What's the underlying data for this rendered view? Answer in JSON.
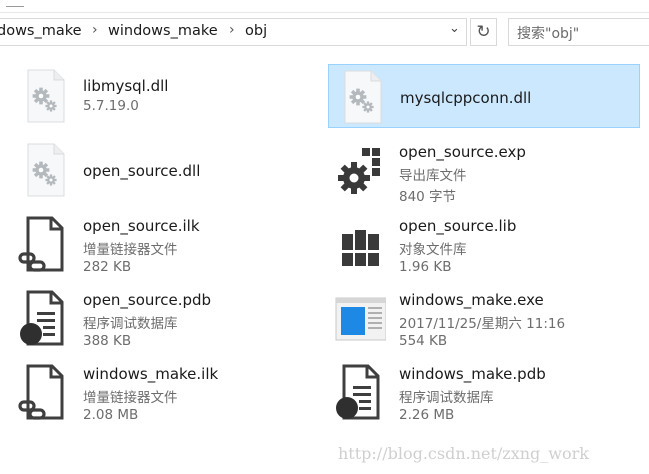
{
  "address": {
    "crumbs": [
      "dows_make",
      "windows_make",
      "obj"
    ],
    "dropdown_icon": "chevron-down",
    "refresh_icon": "refresh"
  },
  "search": {
    "placeholder": "搜索\"obj\""
  },
  "files": [
    {
      "name": "libmysql.dll",
      "detail": "5.7.19.0",
      "icon": "dll-gear-icon"
    },
    {
      "name": "mysqlcppconn.dll",
      "icon": "dll-gear-icon",
      "selected": true
    },
    {
      "name": "open_source.dll",
      "icon": "dll-gear-icon"
    },
    {
      "name": "open_source.exp",
      "type": "导出库文件",
      "size": "840 字节",
      "icon": "exp-gear-icon"
    },
    {
      "name": "open_source.ilk",
      "type": "增量链接器文件",
      "size": "282 KB",
      "icon": "ilk-chain-icon"
    },
    {
      "name": "open_source.lib",
      "type": "对象文件库",
      "size": "1.96 KB",
      "icon": "lib-books-icon"
    },
    {
      "name": "open_source.pdb",
      "type": "程序调试数据库",
      "size": "388 KB",
      "icon": "pdb-icon"
    },
    {
      "name": "windows_make.exe",
      "type": "2017/11/25/星期六 11:16",
      "size": "554 KB",
      "icon": "exe-window-icon"
    },
    {
      "name": "windows_make.ilk",
      "type": "增量链接器文件",
      "size": "2.08 MB",
      "icon": "ilk-chain-icon"
    },
    {
      "name": "windows_make.pdb",
      "type": "程序调试数据库",
      "size": "2.26 MB",
      "icon": "pdb-icon"
    }
  ],
  "watermark": "http://blog.csdn.net/zxng_work"
}
